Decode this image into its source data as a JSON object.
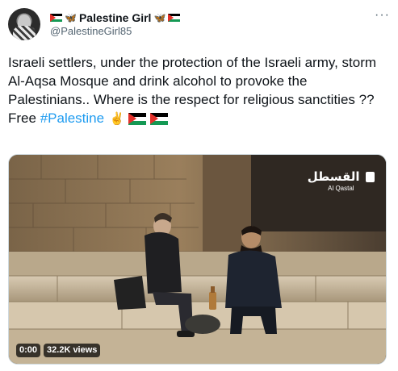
{
  "author": {
    "display_name": "Palestine Girl",
    "handle": "@PalestineGirl85"
  },
  "tweet": {
    "text": "Israeli settlers, under the protection of the Israeli army, storm Al-Aqsa Mosque and drink alcohol to provoke the Palestinians.. Where is the respect for religious sanctities ??",
    "free_prefix": "Free",
    "hashtag": "#Palestine",
    "peace_emoji": "✌️"
  },
  "media": {
    "channel_name_ar": "القسطل",
    "channel_name_en": "Al Qastal",
    "timestamp": "0:00",
    "views": "32.2K views"
  },
  "icons": {
    "more": "more-icon",
    "flag": "palestine-flag-icon",
    "butterfly": "butterfly-icon"
  },
  "colors": {
    "link": "#1d9bf0",
    "secondary_text": "#536471",
    "flag_red": "#e4312b",
    "flag_green": "#149954"
  }
}
